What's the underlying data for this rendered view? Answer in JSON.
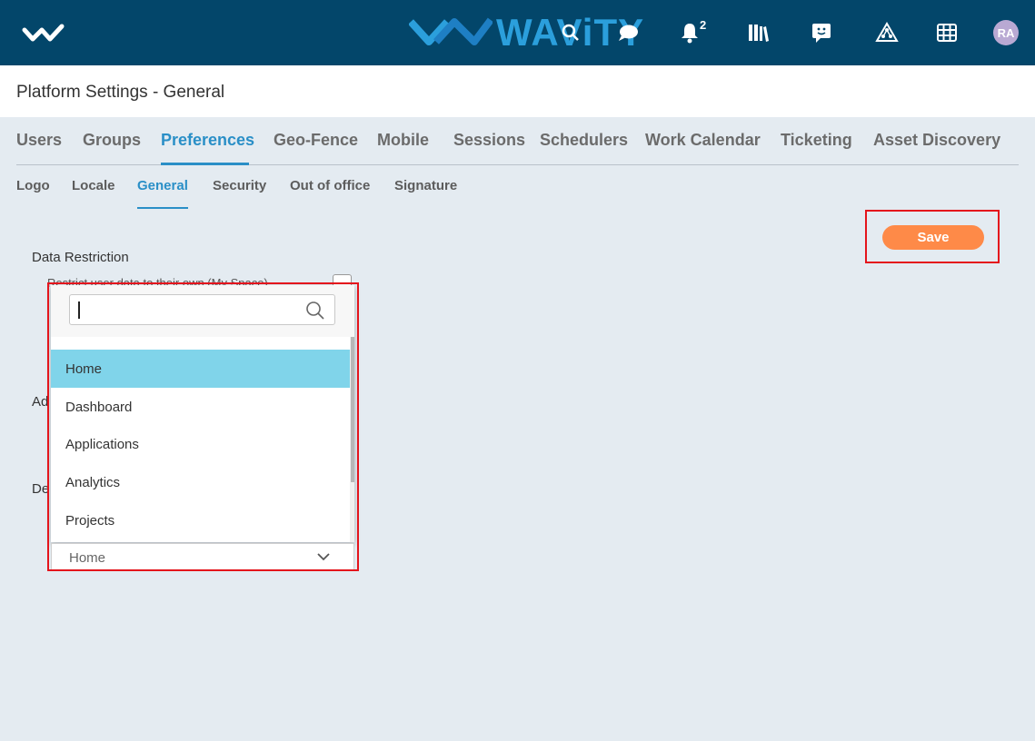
{
  "topbar": {
    "brand": "WAViTY",
    "notification_count": "2",
    "avatar_initials": "RA",
    "icons": [
      "app-logo-icon",
      "search-icon",
      "chat-icon",
      "bell-icon",
      "library-icon",
      "feedback-icon",
      "network-icon",
      "grid-icon"
    ],
    "colors": {
      "background": "#03466a",
      "brand": "#2b9fdc"
    }
  },
  "page_title": "Platform Settings - General",
  "main_tabs": [
    {
      "label": "Users"
    },
    {
      "label": "Groups"
    },
    {
      "label": "Preferences"
    },
    {
      "label": "Geo-Fence"
    },
    {
      "label": "Mobile"
    },
    {
      "label": "Sessions"
    },
    {
      "label": "Schedulers"
    },
    {
      "label": "Work Calendar"
    },
    {
      "label": "Ticketing"
    },
    {
      "label": "Asset Discovery"
    }
  ],
  "active_main_tab": "Preferences",
  "sub_tabs": [
    {
      "label": "Logo"
    },
    {
      "label": "Locale"
    },
    {
      "label": "General"
    },
    {
      "label": "Security"
    },
    {
      "label": "Out of office"
    },
    {
      "label": "Signature"
    }
  ],
  "active_sub_tab": "General",
  "save_label": "Save",
  "form": {
    "data_restriction_label": "Data Restriction",
    "restrict_option_text": "Restrict user data to their own (My Space)",
    "second_label": "Ad",
    "third_label": "De"
  },
  "dropdown": {
    "search_value": "",
    "options": [
      {
        "label": "Home"
      },
      {
        "label": "Dashboard"
      },
      {
        "label": "Applications"
      },
      {
        "label": "Analytics"
      },
      {
        "label": "Projects"
      }
    ],
    "selected_value": "Home"
  },
  "colors": {
    "accent": "#2a8fc7",
    "save": "#fe8a48",
    "option_selected": "#80d4ea",
    "highlight": "#e4141c"
  }
}
